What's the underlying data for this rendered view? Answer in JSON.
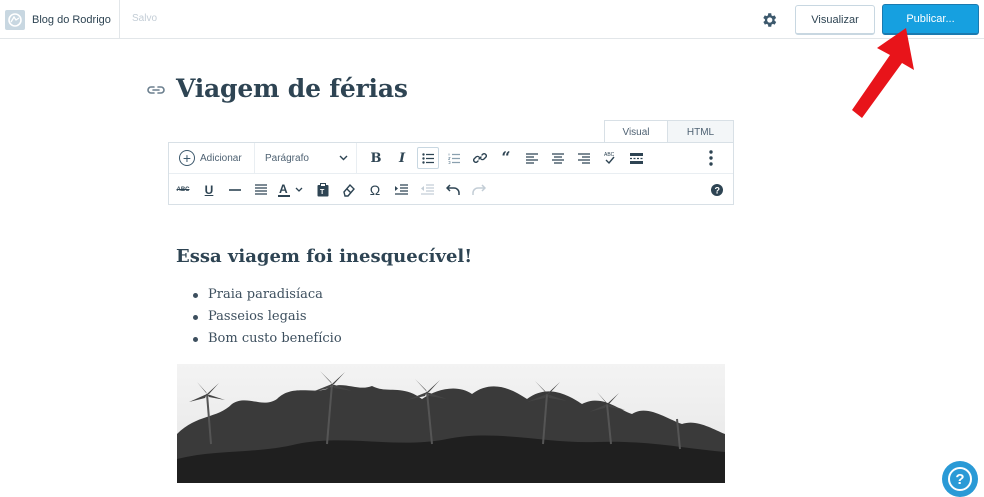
{
  "header": {
    "site_name": "Blog do Rodrigo",
    "save_status": "Salvo",
    "preview_label": "Visualizar",
    "publish_label": "Publicar...",
    "publish_color": "#16a0e0"
  },
  "editor": {
    "post_title": "Viagem de férias",
    "tabs": [
      {
        "label": "Visual",
        "active": true
      },
      {
        "label": "HTML",
        "active": false
      }
    ],
    "toolbar": {
      "add_label": "Adicionar",
      "format_select": "Parágrafo",
      "row1_icons": [
        "bold-icon",
        "italic-icon",
        "bullet-list-icon",
        "numbered-list-icon",
        "link-icon",
        "blockquote-icon",
        "align-left-icon",
        "align-center-icon",
        "align-right-icon",
        "spellcheck-icon",
        "read-more-icon",
        "more-vertical-icon"
      ],
      "row2_icons": [
        "strikethrough-icon",
        "underline-icon",
        "horizontal-line-icon",
        "justify-icon",
        "text-color-icon",
        "paste-text-icon",
        "clear-formatting-icon",
        "special-character-icon",
        "indent-icon",
        "outdent-icon",
        "undo-icon",
        "redo-icon",
        "help-icon"
      ]
    },
    "content": {
      "heading": "Essa viagem foi inesquecível!",
      "list": [
        "Praia paradisíaca",
        "Passeios legais",
        "Bom custo benefício"
      ]
    }
  },
  "colors": {
    "annotation_arrow": "#e8141a",
    "text_primary": "#2e4453"
  }
}
